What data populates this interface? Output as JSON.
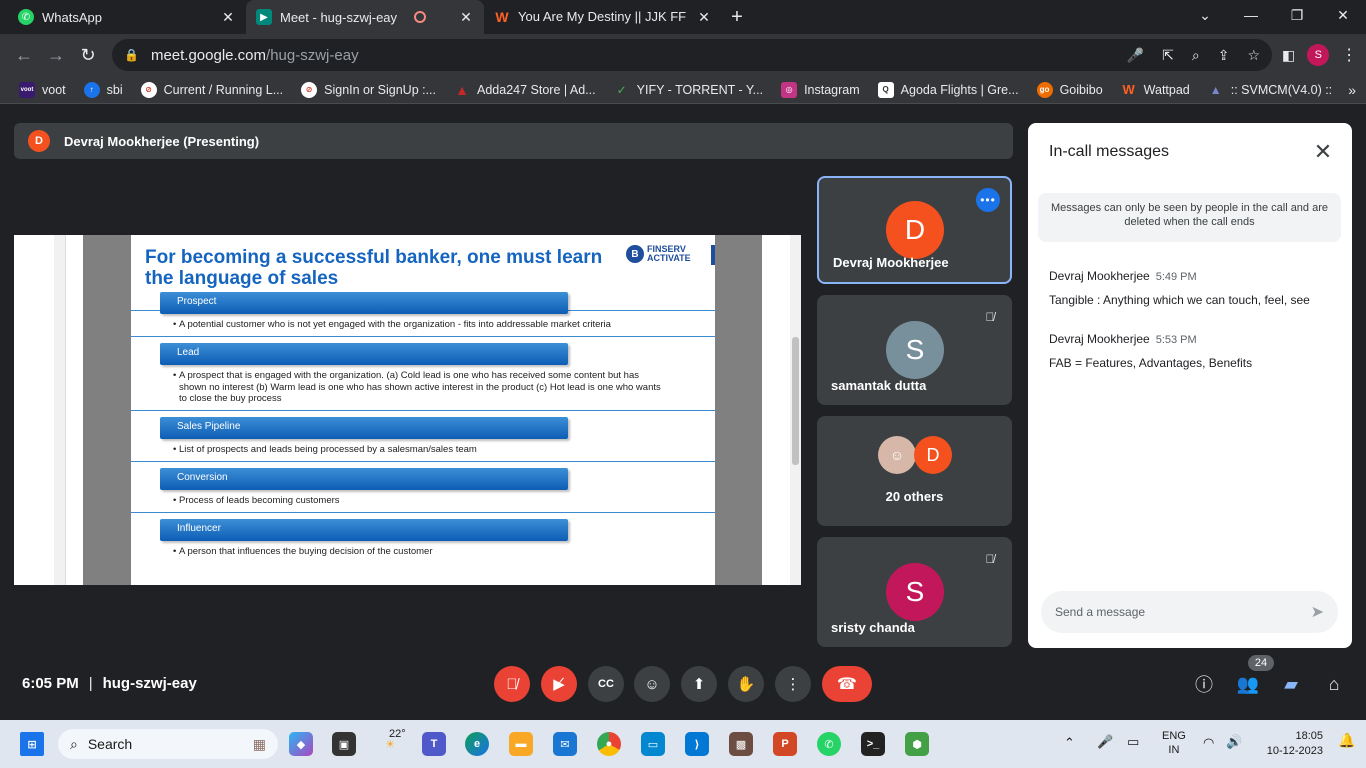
{
  "browser": {
    "tabs": [
      {
        "title": "WhatsApp",
        "favicon": "whatsapp-icon",
        "color": "#25d366",
        "active": false
      },
      {
        "title": "Meet - hug-szwj-eay",
        "favicon": "meet-icon",
        "color": "#00897b",
        "active": true
      },
      {
        "title": "You Are My Destiny || JJK FF || ✓",
        "favicon": "wattpad-icon",
        "color": "#ff6122",
        "active": false
      }
    ],
    "url_host": "meet.google.com",
    "url_path": "/hug-szwj-eay",
    "profile_initial": "S",
    "bookmarks": [
      {
        "label": "voot",
        "color": "#3a1a6e",
        "glyph": "voot"
      },
      {
        "label": "sbi",
        "color": "#1a73e8",
        "glyph": "↑"
      },
      {
        "label": "Current / Running L...",
        "color": "#d93025",
        "glyph": "⊘"
      },
      {
        "label": "SignIn or SignUp :...",
        "color": "#d93025",
        "glyph": "⊘"
      },
      {
        "label": "Adda247 Store | Ad...",
        "color": "#c62828",
        "glyph": "▲"
      },
      {
        "label": "YIFY - TORRENT - Y...",
        "color": "#4caf50",
        "glyph": "✓"
      },
      {
        "label": "Instagram",
        "color": "#c13584",
        "glyph": "◎"
      },
      {
        "label": "Agoda Flights | Gre...",
        "color": "#555555",
        "glyph": "Q"
      },
      {
        "label": "Goibibo",
        "color": "#ef6c00",
        "glyph": "go"
      },
      {
        "label": "Wattpad",
        "color": "#ff6122",
        "glyph": "W"
      },
      {
        "label": ":: SVMCM(V4.0) ::",
        "color": "#5c6bc0",
        "glyph": "▲"
      }
    ]
  },
  "meet": {
    "presenter_initial": "D",
    "presenter_label": "Devraj Mookherjee (Presenting)",
    "time": "6:05 PM",
    "meeting_code": "hug-szwj-eay",
    "participant_count": "24",
    "slide": {
      "title": "For becoming a successful banker, one must learn the language of sales",
      "brand_line1": "FINSERV",
      "brand_line2": "ACTIVATE",
      "terms": [
        {
          "term": "Prospect",
          "definition": "A potential customer who is not yet engaged with the organization - fits into addressable market criteria"
        },
        {
          "term": "Lead",
          "definition": "A prospect that is engaged with the organization. (a) Cold lead is one who has received some content but has shown no interest (b) Warm lead is one who has shown active interest in the product (c) Hot lead is one who wants to close the buy process"
        },
        {
          "term": "Sales Pipeline",
          "definition": "List of prospects and leads being processed by a salesman/sales team"
        },
        {
          "term": "Conversion",
          "definition": "Process of leads becoming customers"
        },
        {
          "term": "Influencer",
          "definition": "A person that influences the buying decision of the customer"
        }
      ]
    },
    "tiles": [
      {
        "initial": "D",
        "name": "Devraj Mookherjee",
        "color": "#f4511e"
      },
      {
        "initial": "S",
        "name": "samantak dutta",
        "color": "#78909c"
      },
      {
        "initial": "D",
        "name": "20 others",
        "color": "#f4511e"
      },
      {
        "initial": "S",
        "name": "sristy chanda",
        "color": "#c2185b"
      }
    ],
    "chat": {
      "title": "In-call messages",
      "note": "Messages can only be seen by people in the call and are deleted when the call ends",
      "messages": [
        {
          "sender": "Devraj Mookherjee",
          "time": "5:49 PM",
          "text": "Tangible : Anything which we can touch, feel, see"
        },
        {
          "sender": "Devraj Mookherjee",
          "time": "5:53 PM",
          "text": "FAB = Features, Advantages, Benefits"
        }
      ],
      "input_placeholder": "Send a message"
    }
  },
  "taskbar": {
    "search_label": "Search",
    "weather": "22°",
    "lang_line1": "ENG",
    "lang_line2": "IN",
    "clock_time": "18:05",
    "clock_date": "10-12-2023"
  }
}
